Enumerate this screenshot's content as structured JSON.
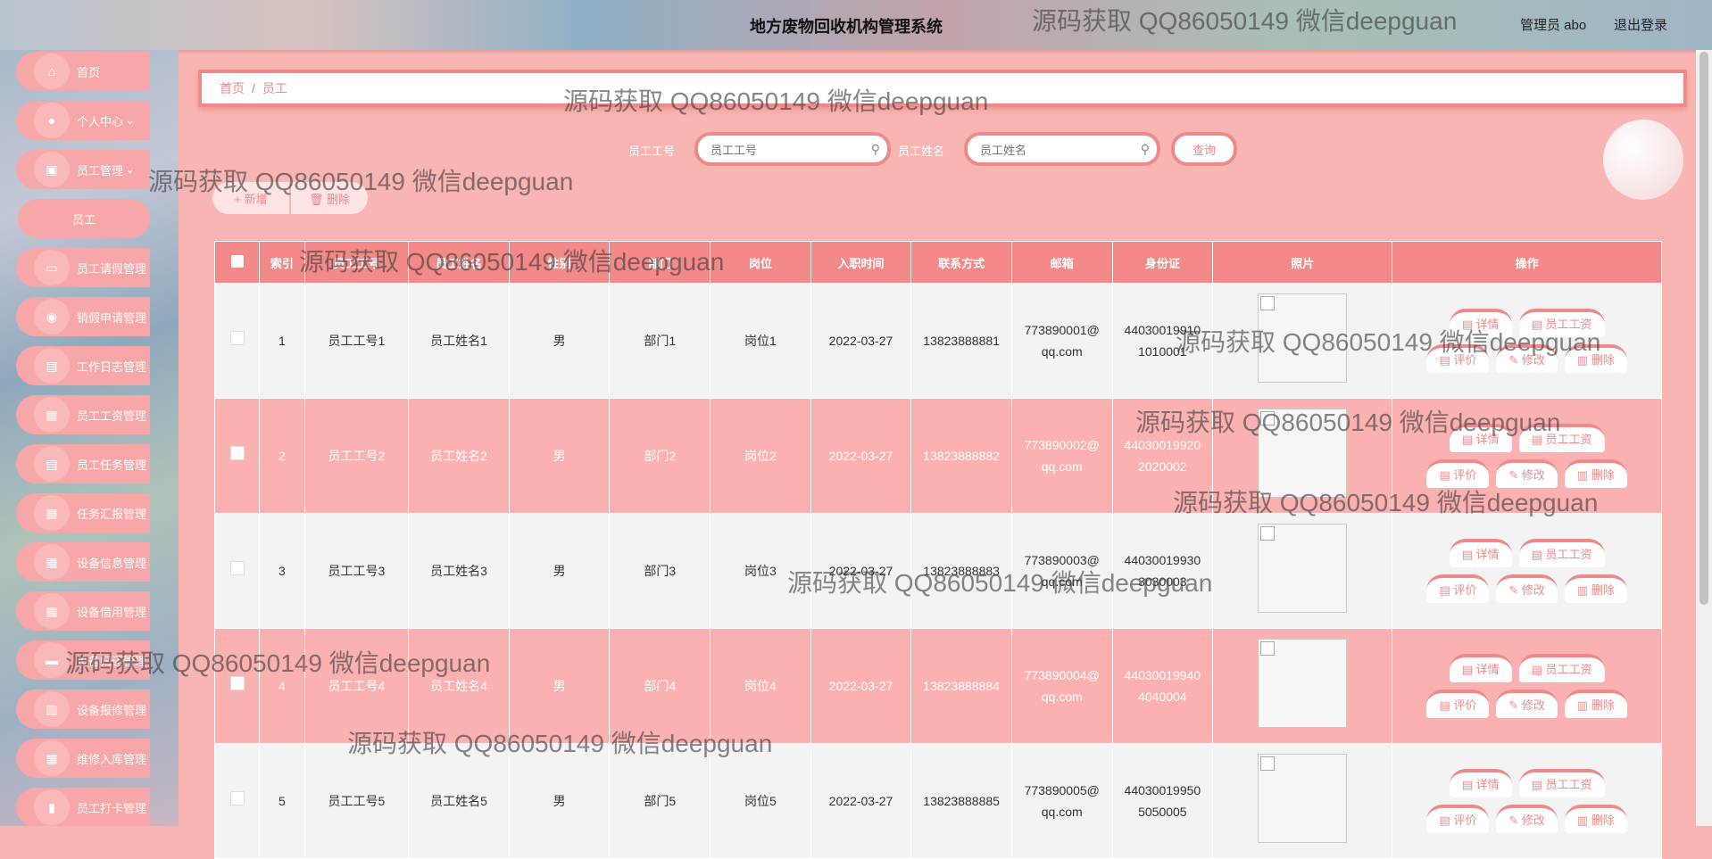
{
  "header": {
    "title": "地方废物回收机构管理系统",
    "user": "管理员 abo",
    "logout": "退出登录"
  },
  "sidebar": {
    "items": [
      {
        "label": "首页",
        "icon": "home-icon"
      },
      {
        "label": "个人中心",
        "icon": "user-icon",
        "chevron": true
      },
      {
        "label": "员工管理",
        "icon": "staff-icon",
        "chevron": true
      },
      {
        "label": "员工",
        "sub": true
      },
      {
        "label": "员工请假管理",
        "icon": "briefcase-icon"
      },
      {
        "label": "销假申请管理",
        "icon": "pin-icon"
      },
      {
        "label": "工作日志管理",
        "icon": "clipboard-icon"
      },
      {
        "label": "员工工资管理",
        "icon": "grid-icon"
      },
      {
        "label": "员工任务管理",
        "icon": "clipboard-icon"
      },
      {
        "label": "任务汇报管理",
        "icon": "grid-icon"
      },
      {
        "label": "设备信息管理",
        "icon": "grid-icon"
      },
      {
        "label": "设备借用管理",
        "icon": "grid-icon"
      },
      {
        "label": "设备归还管理",
        "icon": "chat-icon"
      },
      {
        "label": "设备报修管理",
        "icon": "chart-icon"
      },
      {
        "label": "维修入库管理",
        "icon": "grid-icon"
      },
      {
        "label": "员工打卡管理",
        "icon": "bar-chart-icon"
      }
    ]
  },
  "breadcrumb": {
    "home": "首页",
    "sep": "/",
    "current": "员工"
  },
  "search": {
    "no_label": "员工工号",
    "no_placeholder": "员工工号",
    "name_label": "员工姓名",
    "name_placeholder": "员工姓名",
    "query_button": "查询"
  },
  "actions": {
    "add": "+ 新增",
    "delete": "🗑 删除"
  },
  "table": {
    "headers": [
      "索引",
      "员工工号",
      "员工姓名",
      "性别",
      "部门",
      "岗位",
      "入职时间",
      "联系方式",
      "邮箱",
      "身份证",
      "照片",
      "操作"
    ],
    "rows": [
      {
        "idx": "1",
        "no": "员工工号1",
        "name": "员工姓名1",
        "sex": "男",
        "dept": "部门1",
        "post": "岗位1",
        "date": "2022-03-27",
        "phone": "13823888881",
        "email": "773890001@qq.com",
        "id": "440300199101010001"
      },
      {
        "idx": "2",
        "no": "员工工号2",
        "name": "员工姓名2",
        "sex": "男",
        "dept": "部门2",
        "post": "岗位2",
        "date": "2022-03-27",
        "phone": "13823888882",
        "email": "773890002@qq.com",
        "id": "440300199202020002"
      },
      {
        "idx": "3",
        "no": "员工工号3",
        "name": "员工姓名3",
        "sex": "男",
        "dept": "部门3",
        "post": "岗位3",
        "date": "2022-03-27",
        "phone": "13823888883",
        "email": "773890003@qq.com",
        "id": "440300199303030003"
      },
      {
        "idx": "4",
        "no": "员工工号4",
        "name": "员工姓名4",
        "sex": "男",
        "dept": "部门4",
        "post": "岗位4",
        "date": "2022-03-27",
        "phone": "13823888884",
        "email": "773890004@qq.com",
        "id": "440300199404040004"
      },
      {
        "idx": "5",
        "no": "员工工号5",
        "name": "员工姓名5",
        "sex": "男",
        "dept": "部门5",
        "post": "岗位5",
        "date": "2022-03-27",
        "phone": "13823888885",
        "email": "773890005@qq.com",
        "id": "440300199505050005"
      }
    ],
    "op_labels": {
      "detail": "详情",
      "salary": "员工工资",
      "review": "评价",
      "edit": "修改",
      "delete": "删除"
    }
  },
  "watermark": "源码获取 QQ86050149 微信deepguan"
}
